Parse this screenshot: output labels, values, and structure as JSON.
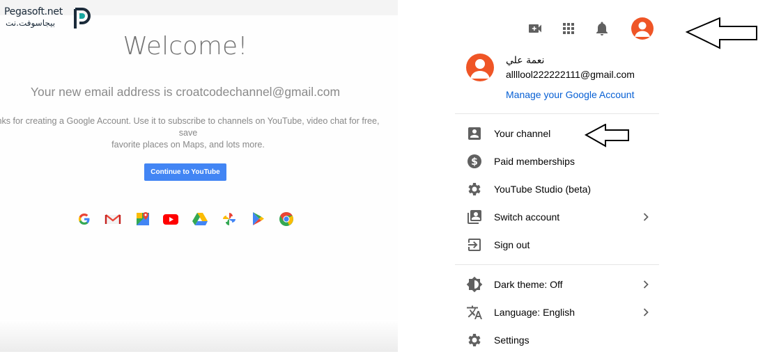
{
  "watermark": {
    "line1": "Pegasoft.net",
    "line2": "بيجاسوفت.نت"
  },
  "welcome_page": {
    "title": "Welcome!",
    "new_email_text": "Your new email address is croatcodechannel@gmail.com",
    "thanks_line1": "nks for creating a Google Account. Use it to subscribe to channels on YouTube, video chat for free, save",
    "thanks_line2": "favorite places on Maps, and lots more.",
    "continue_button": "Continue to YouTube",
    "apps": [
      "google-icon",
      "gmail-icon",
      "maps-icon",
      "youtube-icon",
      "drive-icon",
      "photos-icon",
      "play-icon",
      "chrome-icon"
    ]
  },
  "topbar": {
    "icons": [
      "create-video-icon",
      "apps-grid-icon",
      "notifications-bell-icon",
      "account-avatar"
    ]
  },
  "account": {
    "name": "نعمة علي",
    "email": "allllool222222111@gmail.com",
    "manage_link": "Manage your Google Account"
  },
  "menu": {
    "section1": [
      {
        "label": "Your channel",
        "icon": "account-box-icon"
      },
      {
        "label": "Paid memberships",
        "icon": "dollar-circle-icon"
      },
      {
        "label": "YouTube Studio (beta)",
        "icon": "gear-icon"
      },
      {
        "label": "Switch account",
        "icon": "switch-account-icon",
        "chevron": true
      },
      {
        "label": "Sign out",
        "icon": "sign-out-icon"
      }
    ],
    "section2": [
      {
        "label": "Dark theme: Off",
        "icon": "brightness-icon",
        "chevron": true
      },
      {
        "label": "Language: English",
        "icon": "translate-icon",
        "chevron": true
      },
      {
        "label": "Settings",
        "icon": "gear-icon"
      }
    ]
  },
  "colors": {
    "avatar": "#ef5526",
    "link": "#065fd4",
    "icon_gray": "#606060",
    "button_blue": "#4285f4"
  }
}
